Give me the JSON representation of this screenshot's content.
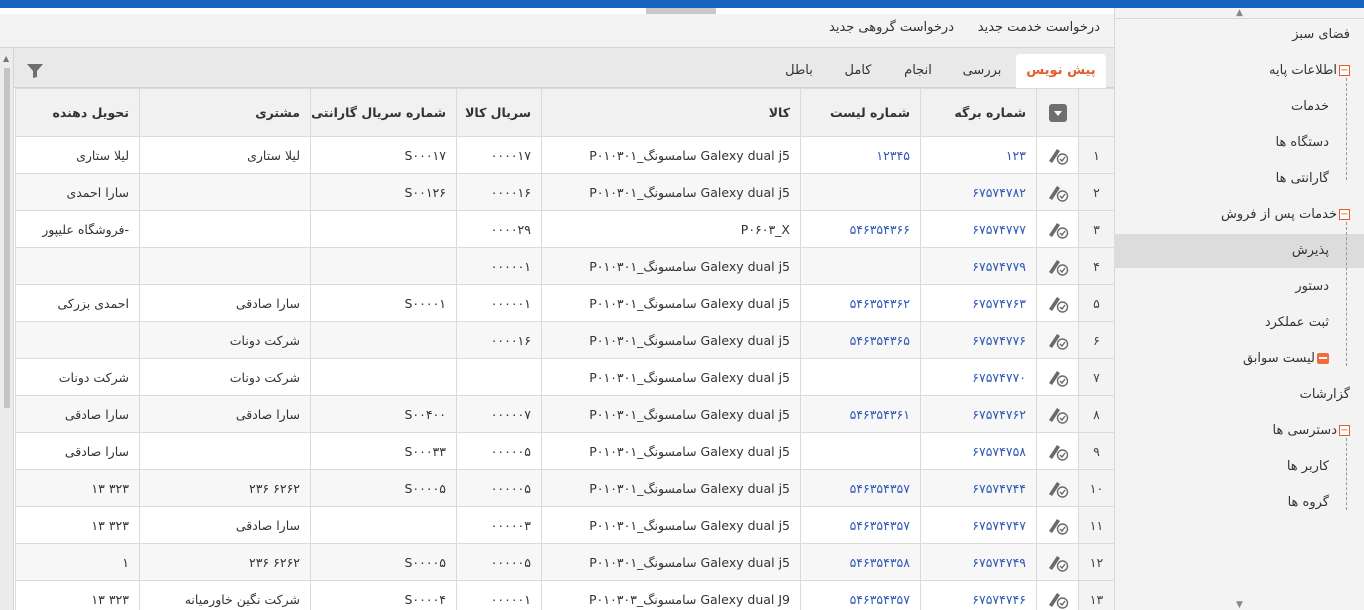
{
  "sidebar": {
    "items": [
      {
        "label": "فضای سبز",
        "level": 0,
        "icon": ""
      },
      {
        "label": "اطلاعات پایه",
        "level": 0,
        "icon": "minus-icon"
      },
      {
        "label": "خدمات",
        "level": 1,
        "icon": ""
      },
      {
        "label": "دستگاه ها",
        "level": 1,
        "icon": ""
      },
      {
        "label": "گارانتی ها",
        "level": 1,
        "icon": ""
      },
      {
        "label": "خدمات پس از فروش",
        "level": 0,
        "icon": "minus-icon"
      },
      {
        "label": "پذیرش",
        "level": 1,
        "icon": "",
        "active": true
      },
      {
        "label": "دستور",
        "level": 1,
        "icon": ""
      },
      {
        "label": "ثبت عملکرد",
        "level": 1,
        "icon": ""
      },
      {
        "label": "لیست سوابق",
        "level": 1,
        "icon": "history-icon"
      },
      {
        "label": "گزارشات",
        "level": 0,
        "icon": ""
      },
      {
        "label": "دسترسی ها",
        "level": 0,
        "icon": "minus-icon"
      },
      {
        "label": "کاربر ها",
        "level": 1,
        "icon": ""
      },
      {
        "label": "گروه ها",
        "level": 1,
        "icon": ""
      }
    ]
  },
  "actions": {
    "new_service_request": "درخواست خدمت جدید",
    "new_group_request": "درخواست گروهی جدید"
  },
  "tabs": [
    {
      "label": "پیش نویس",
      "active": true
    },
    {
      "label": "بررسی"
    },
    {
      "label": "انجام"
    },
    {
      "label": "کامل"
    },
    {
      "label": "باطل"
    }
  ],
  "table": {
    "columns": [
      "شماره برگه",
      "شماره لیست",
      "کالا",
      "سریال کالا",
      "شماره سریال گارانتی",
      "مشتری",
      "تحویل دهنده"
    ],
    "rows": [
      {
        "num": "۱",
        "sheet": "۱۲۳",
        "list": "۱۲۳۴۵",
        "product": "Galexy dual j5 سامسونگ_P۰۱۰۳۰۱",
        "serial": "۰۰۰۰۱۷",
        "warranty": "S۰۰۰۱۷",
        "customer": "لیلا ستاری",
        "deliverer": "لیلا ستاری"
      },
      {
        "num": "۲",
        "sheet": "۶۷۵۷۴۷۸۲",
        "list": "",
        "product": "Galexy dual j5 سامسونگ_P۰۱۰۳۰۱",
        "serial": "۰۰۰۰۱۶",
        "warranty": "S۰۰۱۲۶",
        "customer": "",
        "deliverer": "سارا احمدی"
      },
      {
        "num": "۳",
        "sheet": "۶۷۵۷۴۷۷۷",
        "list": "۵۴۶۳۵۴۳۶۶",
        "product": "P۰۶۰۳_X",
        "serial": "۰۰۰۰۲۹",
        "warranty": "",
        "customer": "",
        "deliverer": "-فروشگاه علیپور"
      },
      {
        "num": "۴",
        "sheet": "۶۷۵۷۴۷۷۹",
        "list": "",
        "product": "Galexy dual j5 سامسونگ_P۰۱۰۳۰۱",
        "serial": "۰۰۰۰۰۱",
        "warranty": "",
        "customer": "",
        "deliverer": ""
      },
      {
        "num": "۵",
        "sheet": "۶۷۵۷۴۷۶۳",
        "list": "۵۴۶۳۵۴۳۶۲",
        "product": "Galexy dual j5 سامسونگ_P۰۱۰۳۰۱",
        "serial": "۰۰۰۰۰۱",
        "warranty": "S۰۰۰۰۱",
        "customer": "سارا صادقی",
        "deliverer": "احمدی بزرکی"
      },
      {
        "num": "۶",
        "sheet": "۶۷۵۷۴۷۷۶",
        "list": "۵۴۶۳۵۴۳۶۵",
        "product": "Galexy dual j5 سامسونگ_P۰۱۰۳۰۱",
        "serial": "۰۰۰۰۱۶",
        "warranty": "",
        "customer": "شرکت دونات",
        "deliverer": ""
      },
      {
        "num": "۷",
        "sheet": "۶۷۵۷۴۷۷۰",
        "list": "",
        "product": "Galexy dual j5 سامسونگ_P۰۱۰۳۰۱",
        "serial": "",
        "warranty": "",
        "customer": "شرکت دونات",
        "deliverer": "شرکت دونات"
      },
      {
        "num": "۸",
        "sheet": "۶۷۵۷۴۷۶۲",
        "list": "۵۴۶۳۵۴۳۶۱",
        "product": "Galexy dual j5 سامسونگ_P۰۱۰۳۰۱",
        "serial": "۰۰۰۰۰۷",
        "warranty": "S۰۰۴۰۰",
        "customer": "سارا صادقی",
        "deliverer": "سارا صادقی"
      },
      {
        "num": "۹",
        "sheet": "۶۷۵۷۴۷۵۸",
        "list": "",
        "product": "Galexy dual j5 سامسونگ_P۰۱۰۳۰۱",
        "serial": "۰۰۰۰۰۵",
        "warranty": "S۰۰۰۳۳",
        "customer": "",
        "deliverer": "سارا صادقی"
      },
      {
        "num": "۱۰",
        "sheet": "۶۷۵۷۴۷۴۴",
        "list": "۵۴۶۳۵۴۳۵۷",
        "product": "Galexy dual j5 سامسونگ_P۰۱۰۳۰۱",
        "serial": "۰۰۰۰۰۵",
        "warranty": "S۰۰۰۰۵",
        "customer": "۶۲۶۲ ۲۳۶",
        "deliverer": "۳۲۳ ۱۳"
      },
      {
        "num": "۱۱",
        "sheet": "۶۷۵۷۴۷۴۷",
        "list": "۵۴۶۳۵۴۳۵۷",
        "product": "Galexy dual j5 سامسونگ_P۰۱۰۳۰۱",
        "serial": "۰۰۰۰۰۳",
        "warranty": "",
        "customer": "سارا صادقی",
        "deliverer": "۳۲۳ ۱۳"
      },
      {
        "num": "۱۲",
        "sheet": "۶۷۵۷۴۷۴۹",
        "list": "۵۴۶۳۵۴۳۵۸",
        "product": "Galexy dual j5 سامسونگ_P۰۱۰۳۰۱",
        "serial": "۰۰۰۰۰۵",
        "warranty": "S۰۰۰۰۵",
        "customer": "۶۲۶۲ ۲۳۶",
        "deliverer": "۱"
      },
      {
        "num": "۱۳",
        "sheet": "۶۷۵۷۴۷۴۶",
        "list": "۵۴۶۳۵۴۳۵۷",
        "product": "Galexy dual J9 سامسونگ_P۰۱۰۳۰۳",
        "serial": "۰۰۰۰۰۱",
        "warranty": "S۰۰۰۰۴",
        "customer": "شرکت نگین خاورمیانه",
        "deliverer": "۳۲۳ ۱۳"
      }
    ]
  },
  "colors": {
    "accent": "#e35c2b",
    "link": "#2f58b7",
    "topbar": "#1565c0"
  }
}
